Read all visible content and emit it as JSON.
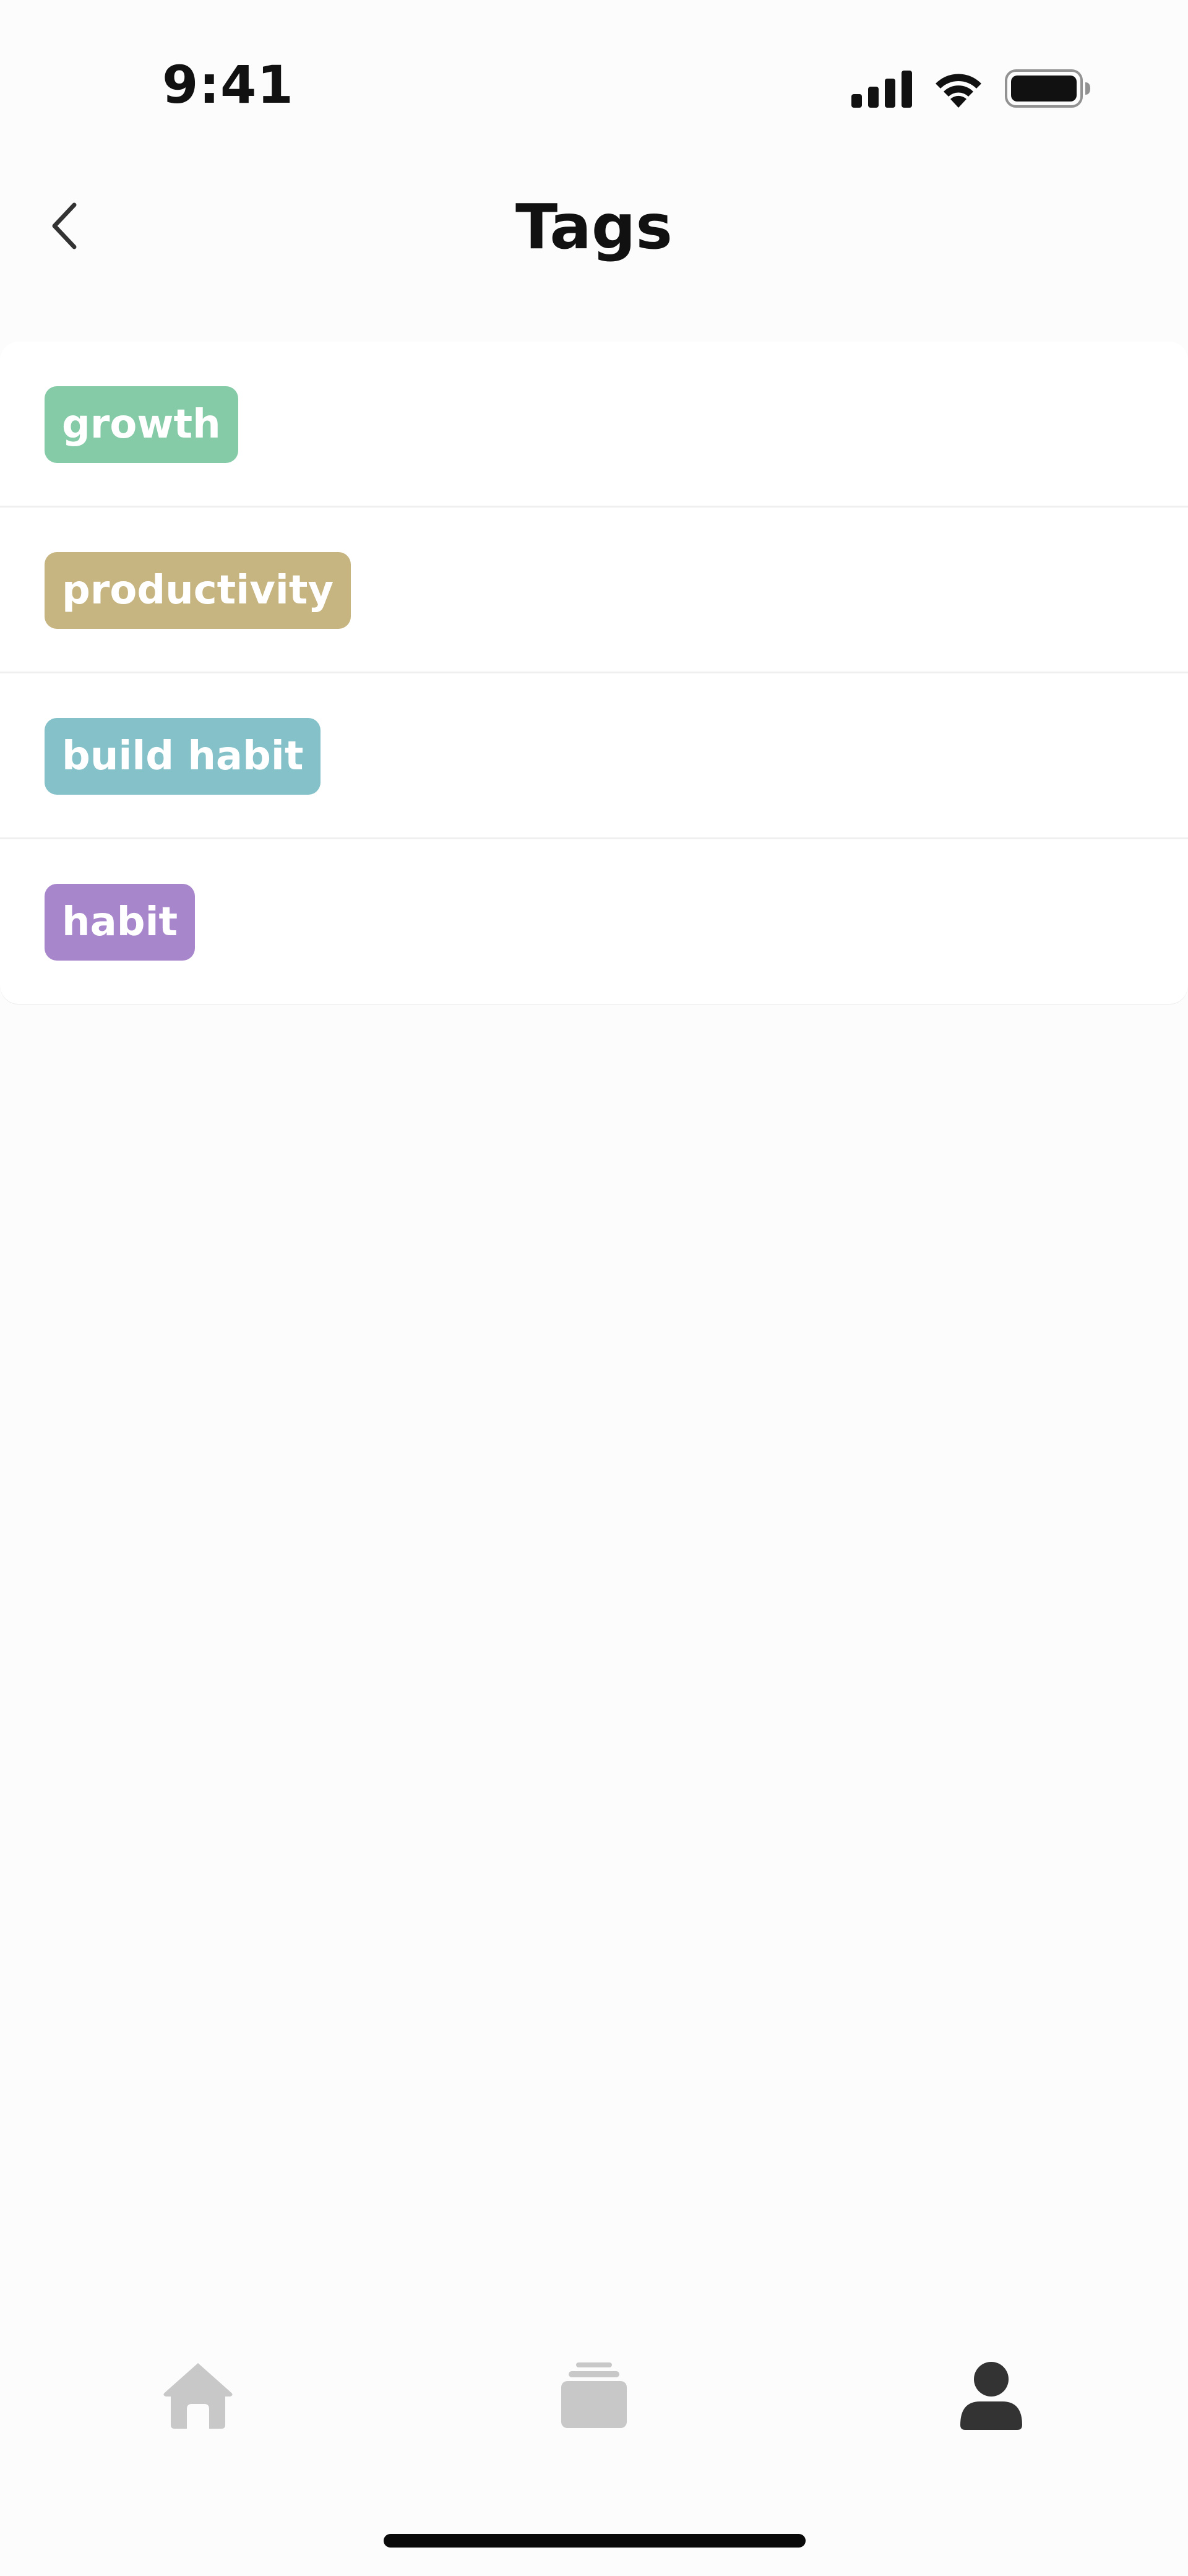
{
  "status_bar": {
    "time": "9:41"
  },
  "header": {
    "title": "Tags",
    "back_icon": "chevron-left-icon"
  },
  "tags": [
    {
      "label": "growth",
      "color": "#86cba8"
    },
    {
      "label": "productivity",
      "color": "#c6b580"
    },
    {
      "label": "build habit",
      "color": "#84c1c8"
    },
    {
      "label": "habit",
      "color": "#a886cc"
    }
  ],
  "tab_bar": {
    "items": [
      {
        "icon": "home-icon",
        "active": false
      },
      {
        "icon": "cards-stack-icon",
        "active": false
      },
      {
        "icon": "person-icon",
        "active": true
      }
    ],
    "active_color": "#333333",
    "inactive_color": "#c8c8c8"
  }
}
